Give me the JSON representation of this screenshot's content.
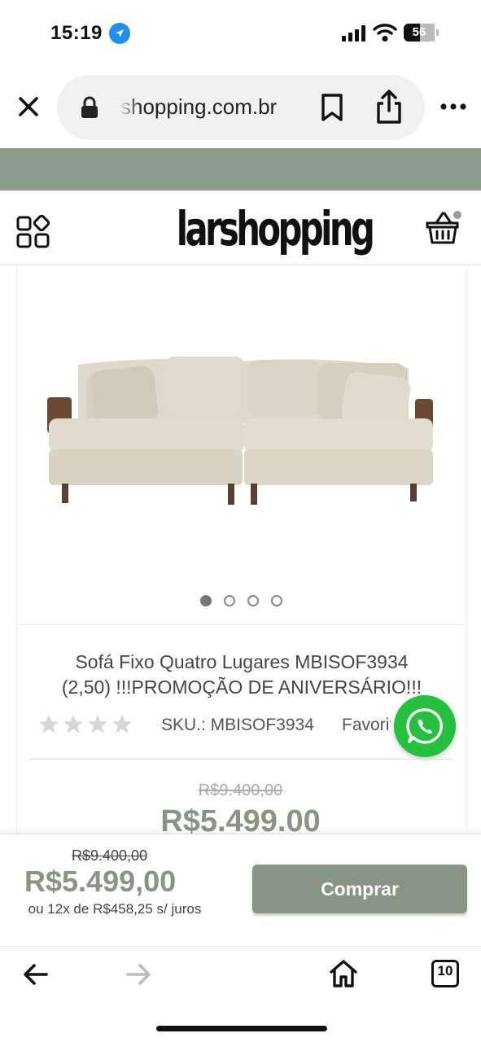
{
  "status_bar": {
    "time": "15:19",
    "battery": "56",
    "icons": [
      "location-icon",
      "signal-icon",
      "wifi-icon",
      "battery-icon"
    ]
  },
  "browser": {
    "url": "shopping.com.br",
    "icons": [
      "close-icon",
      "lock-icon",
      "bookmark-icon",
      "share-icon",
      "more-icon"
    ]
  },
  "site": {
    "logo": "larshopping",
    "icons": [
      "menu-grid-icon",
      "cart-icon"
    ]
  },
  "product": {
    "title_line1": "Sofá Fixo Quatro Lugares MBISOF3934",
    "title_line2": "(2,50) !!!PROMOÇÃO DE ANIVERSÁRIO!!!",
    "sku_label": "SKU.: MBISOF3934",
    "favorite_label": "Favoritar",
    "rating": 0,
    "rating_max": 4,
    "old_price": "R$9.400,00",
    "price": "R$5.499.00",
    "gallery": {
      "count": 4,
      "active": 0
    }
  },
  "buy_bar": {
    "old_price": "R$9.400,00",
    "price": "R$5.499,00",
    "installments": "ou 12x de R$458,25 s/ juros",
    "buy_label": "Comprar"
  },
  "toolbar": {
    "tabs_count": "10",
    "icons": [
      "back-icon",
      "forward-icon",
      "home-icon",
      "tabs-icon"
    ]
  },
  "colors": {
    "brand_green": "#889585",
    "band_green": "#8b9c8f",
    "whatsapp": "#26c03f",
    "location_blue": "#1f8ef1"
  }
}
